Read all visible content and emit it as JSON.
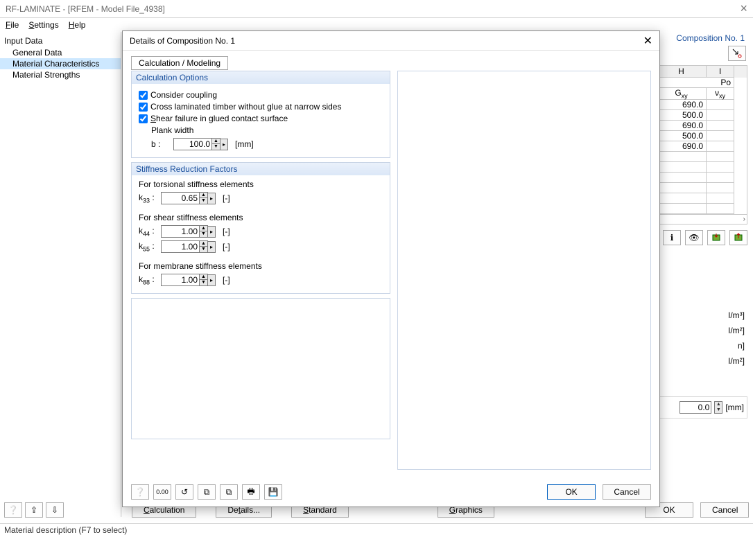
{
  "window": {
    "title": "RF-LAMINATE - [RFEM - Model File_4938]",
    "menus": {
      "file": "File",
      "settings": "Settings",
      "help": "Help"
    },
    "close": "×"
  },
  "tree": {
    "root": "Input Data",
    "items": [
      "General Data",
      "Material Characteristics",
      "Material Strengths"
    ],
    "selected": 1
  },
  "right": {
    "composition_label": "Composition No. 1",
    "headers": {
      "h": "H",
      "i": "I",
      "po": "Po"
    },
    "subheaders": {
      "gxy": "Gxy",
      "vxy": "νxy"
    },
    "rows": [
      "690.0",
      "500.0",
      "690.0",
      "500.0",
      "690.0"
    ],
    "units": [
      "I/m³]",
      "I/m²]",
      "n]",
      "I/m²]"
    ],
    "ref_value": "0.0",
    "ref_unit": "[mm]"
  },
  "bottom": {
    "buttons": [
      "Calculation",
      "Details...",
      "Standard",
      "Graphics",
      "OK",
      "Cancel"
    ]
  },
  "status": "Material description (F7 to select)",
  "modal": {
    "title": "Details of Composition No. 1",
    "tab": "Calculation / Modeling",
    "calc": {
      "title": "Calculation Options",
      "consider": "Consider coupling",
      "clt": "Cross laminated timber without glue at narrow sides",
      "shear": "Shear failure in glued contact surface",
      "plank_label": "Plank width",
      "b_label": "b :",
      "b_value": "100.0",
      "b_unit": "[mm]"
    },
    "stiff": {
      "title": "Stiffness Reduction Factors",
      "tors_label": "For torsional stiffness elements",
      "k33_label": "k33 :",
      "k33_value": "0.65",
      "shear_label": "For shear stiffness elements",
      "k44_label": "k44 :",
      "k44_value": "1.00",
      "k55_label": "k55 :",
      "k55_value": "1.00",
      "memb_label": "For membrane stiffness elements",
      "k88_label": "k88 :",
      "k88_value": "1.00",
      "unit": "[-]"
    },
    "footer": {
      "ok": "OK",
      "cancel": "Cancel"
    }
  }
}
